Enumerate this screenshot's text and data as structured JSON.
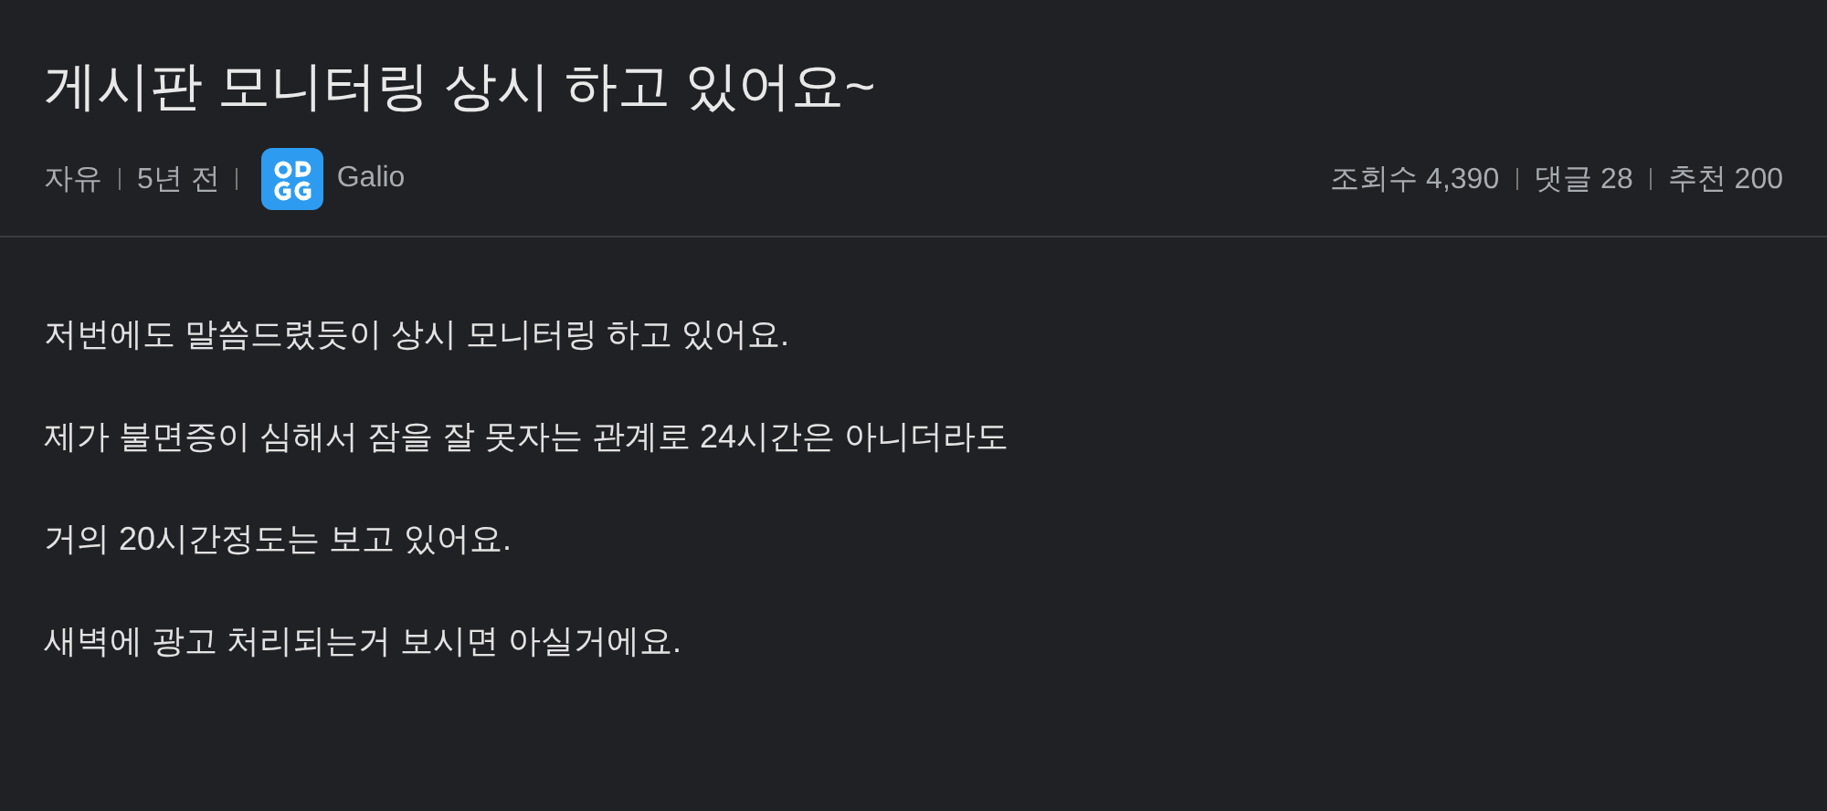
{
  "title": "게시판 모니터링 상시 하고 있어요~",
  "meta": {
    "category": "자유",
    "time": "5년 전",
    "author": "Galio"
  },
  "stats": [
    {
      "label": "조회수",
      "value": "4,390"
    },
    {
      "label": "댓글",
      "value": "28"
    },
    {
      "label": "추천",
      "value": "200"
    }
  ],
  "body": [
    "저번에도 말씀드렸듯이 상시 모니터링 하고 있어요.",
    "제가 불면증이 심해서 잠을 잘 못자는 관계로 24시간은 아니더라도",
    "거의 20시간정도는 보고 있어요.",
    "새벽에 광고 처리되는거 보시면 아실거에요."
  ]
}
